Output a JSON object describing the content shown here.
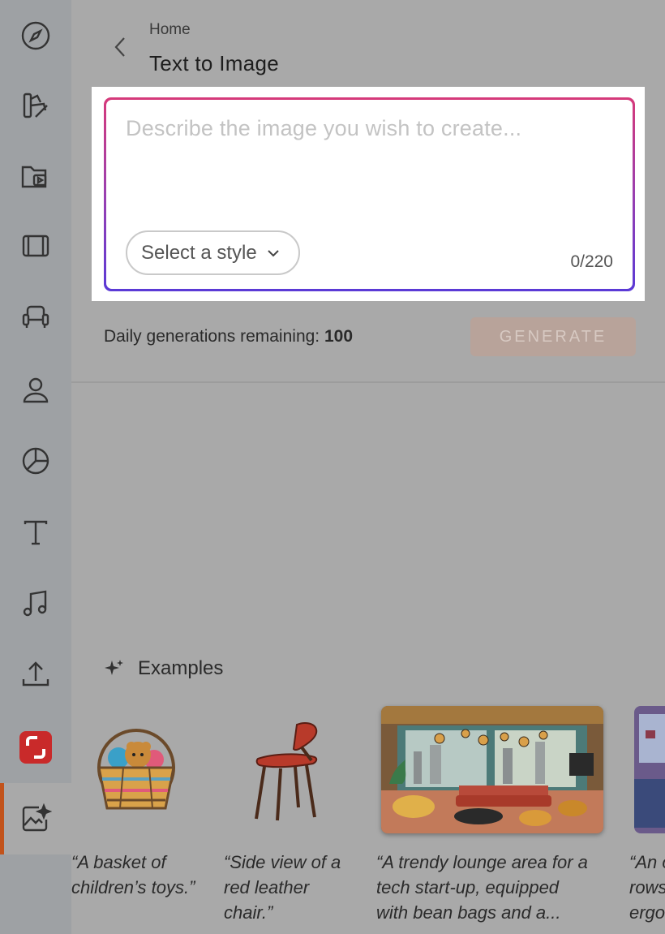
{
  "breadcrumb": "Home",
  "page_title": "Text to Image",
  "prompt": {
    "placeholder": "Describe the image you wish to create...",
    "counter": "0/220"
  },
  "style_select": {
    "label": "Select a style"
  },
  "daily": {
    "label": "Daily generations remaining: ",
    "count": "100"
  },
  "generate_label": "GENERATE",
  "examples": {
    "heading": "Examples",
    "items": [
      {
        "caption_l1": "“A basket of",
        "caption_l2": "children’s toys.”",
        "caption_l3": ""
      },
      {
        "caption_l1": "“Side view of a",
        "caption_l2": "red leather",
        "caption_l3": "chair.”"
      },
      {
        "caption_l1": "“A trendy lounge area for a",
        "caption_l2": "tech start-up, equipped",
        "caption_l3": "with bean bags and a..."
      },
      {
        "caption_l1": "“An o",
        "caption_l2": "rows",
        "caption_l3": "ergo"
      }
    ]
  },
  "sidebar": [
    "compass-icon",
    "palette-icon",
    "folder-video-icon",
    "film-icon",
    "armchair-icon",
    "user-icon",
    "pie-chart-icon",
    "text-icon",
    "music-icon",
    "upload-icon",
    "red-app-icon",
    "ai-image-icon"
  ],
  "colors": {
    "accent": "#c2531b",
    "gradient_top": "#d63a7a",
    "gradient_bottom": "#5a3ad6",
    "red_app": "#c92a2a"
  }
}
